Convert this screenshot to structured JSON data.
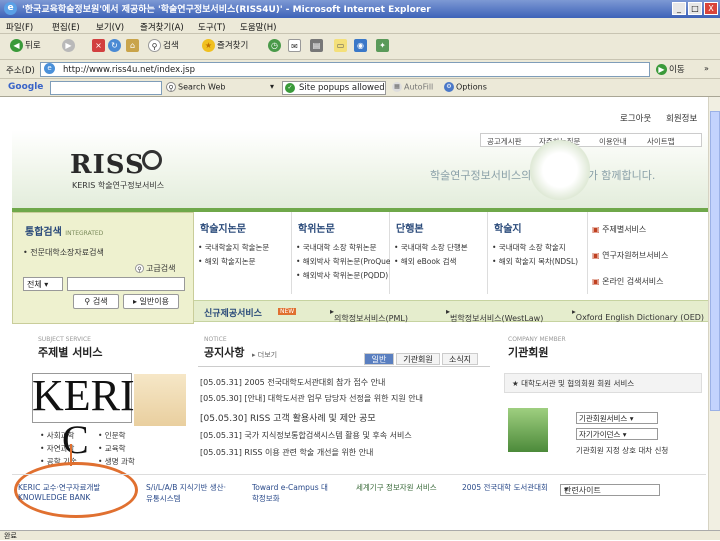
{
  "window": {
    "title": "'한국교육학술정보원'에서 제공하는 '학술연구정보서비스(RISS4U)' - Microsoft Internet Explorer",
    "controls": [
      "_",
      "□",
      "X"
    ]
  },
  "menu": [
    "파일(F)",
    "편집(E)",
    "보기(V)",
    "즐겨찾기(A)",
    "도구(T)",
    "도움말(H)"
  ],
  "toolbar": {
    "back": "뒤로",
    "search": "검색",
    "favorites": "즐겨찾기"
  },
  "address": {
    "label": "주소(D)",
    "url": "http://www.riss4u.net/index.jsp",
    "go": "이동",
    "links": "»"
  },
  "google": {
    "logo": "Google",
    "search_web": "Search Web",
    "popups_blocked": "Site popups allowed",
    "autofill": "AutoFill",
    "options": "Options"
  },
  "site": {
    "top_links": [
      "로그아웃",
      "회원정보"
    ],
    "util_links": [
      "공고게시판",
      "자주하는질문",
      "이용안내",
      "사이트맵"
    ],
    "logo": "RISS",
    "logo_sub": "KERIS 학술연구정보서비스",
    "slogan": "학술연구정보서비스의 중심! RISS가 함께합니다.",
    "search": {
      "title": "통합검색",
      "title_en": "INTEGRATED",
      "sub": "• 전문대학소장자료검색",
      "advanced": "고급검색",
      "select": "전체",
      "search_btn": "검색",
      "simple_btn": "일반이용"
    },
    "columns": [
      {
        "head": "학술지논문",
        "items": [
          "• 국내학술지 학술논문",
          "• 해외 학술지논문"
        ]
      },
      {
        "head": "학위논문",
        "items": [
          "• 국내대학 소장 학위논문",
          "• 해외박사 학위논문(ProQuest)",
          "• 해외박사 학위논문(PQDD)"
        ]
      },
      {
        "head": "단행본",
        "items": [
          "• 국내대학 소장 단행본",
          "• 해외 eBook 검색"
        ]
      },
      {
        "head": "학술지",
        "items": [
          "• 국내대학 소장 학술지",
          "• 해외 학술지 목차(NDSL)"
        ]
      }
    ],
    "right_items": [
      "주제별서비스",
      "연구자원허브서비스",
      "온라인 검색서비스"
    ],
    "new_services": {
      "label": "신규제공서비스",
      "tag": "NEW",
      "items": [
        "의학정보서비스(PML)",
        "법학정보서비스(WestLaw)",
        "Oxford English Dictionary (OED)"
      ]
    },
    "notice": {
      "title": "공지사항",
      "title_en": "NOTICE",
      "more": "더보기",
      "tabs": [
        "일반",
        "기관회원",
        "소식지"
      ],
      "items": [
        "[05.05.31] 2005 전국대학도서관대회 참가 접수 안내",
        "[05.05.30] [안내] 대학도서관 업무 담당자 선정을 위한 지원 안내",
        "[05.05.30] RISS 고객 활용사례 및 제안 공모",
        "[05.05.31] 국가 지식정보통합검색시스템 활용 및 후속 서비스",
        "[05.05.31] RISS 이용 관련 학술 개선을 위한 안내"
      ]
    },
    "subject": {
      "title": "주제별 서비스",
      "title_en": "SUBJECT SERVICE",
      "items": [
        "• 사회과학",
        "• 자연과학",
        "• 공학 기술",
        "• 인문학",
        "• 교육학",
        "• 생명 과학"
      ]
    },
    "member": {
      "title": "기관회원",
      "title_en": "COMPANY MEMBER",
      "items": [
        "★ 대학도서관 및 협의회원 회원 서비스",
        "기관회원서비스",
        "자기가이던스",
        "기관회원 지정 상호 대차 신청"
      ]
    },
    "overlay": {
      "line1": "KERI",
      "line2": "C"
    },
    "banners": [
      "KERIC 교수·연구자료개발 KNOWLEDGE BANK",
      "S/i/L/A/B 지식기반 생산·유통시스템",
      "Toward e-Campus 대학정보화",
      "세계기구 정보자원 서비스",
      "2005 전국대학 도서관대회",
      "관련사이트"
    ]
  },
  "status": "완료"
}
